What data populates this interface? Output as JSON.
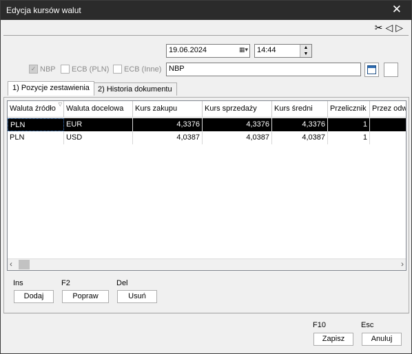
{
  "window": {
    "title": "Edycja kursów walut",
    "close_glyph": "✕"
  },
  "toolbar": {
    "cut_icon": "scissors-icon",
    "prev_icon": "triangle-left-icon",
    "next_icon": "triangle-right-icon"
  },
  "filters": {
    "date": "19.06.2024",
    "time": "14:44",
    "source_text": "NBP",
    "nbp": {
      "label": "NBP",
      "checked": true
    },
    "ecb_pln": {
      "label": "ECB (PLN)",
      "checked": false
    },
    "ecb_other": {
      "label": "ECB (Inne)",
      "checked": false
    }
  },
  "tabs": [
    {
      "label": "1) Pozycje zestawienia",
      "active": true
    },
    {
      "label": "2) Historia dokumentu",
      "active": false
    }
  ],
  "table": {
    "columns": [
      "Waluta źródło",
      "Waluta docelowa",
      "Kurs zakupu",
      "Kurs sprzedaży",
      "Kurs średni",
      "Przelicznik",
      "Przez odw"
    ],
    "rows": [
      [
        "PLN",
        "EUR",
        "4,3376",
        "4,3376",
        "4,3376",
        "1",
        ""
      ],
      [
        "PLN",
        "USD",
        "4,0387",
        "4,0387",
        "4,0387",
        "1",
        ""
      ]
    ],
    "selected_row": 0
  },
  "actions": {
    "add": {
      "key": "Ins",
      "label": "Dodaj"
    },
    "edit": {
      "key": "F2",
      "label": "Popraw"
    },
    "delete": {
      "key": "Del",
      "label": "Usuń"
    }
  },
  "footer": {
    "save": {
      "key": "F10",
      "label": "Zapisz"
    },
    "cancel": {
      "key": "Esc",
      "label": "Anuluj"
    }
  }
}
